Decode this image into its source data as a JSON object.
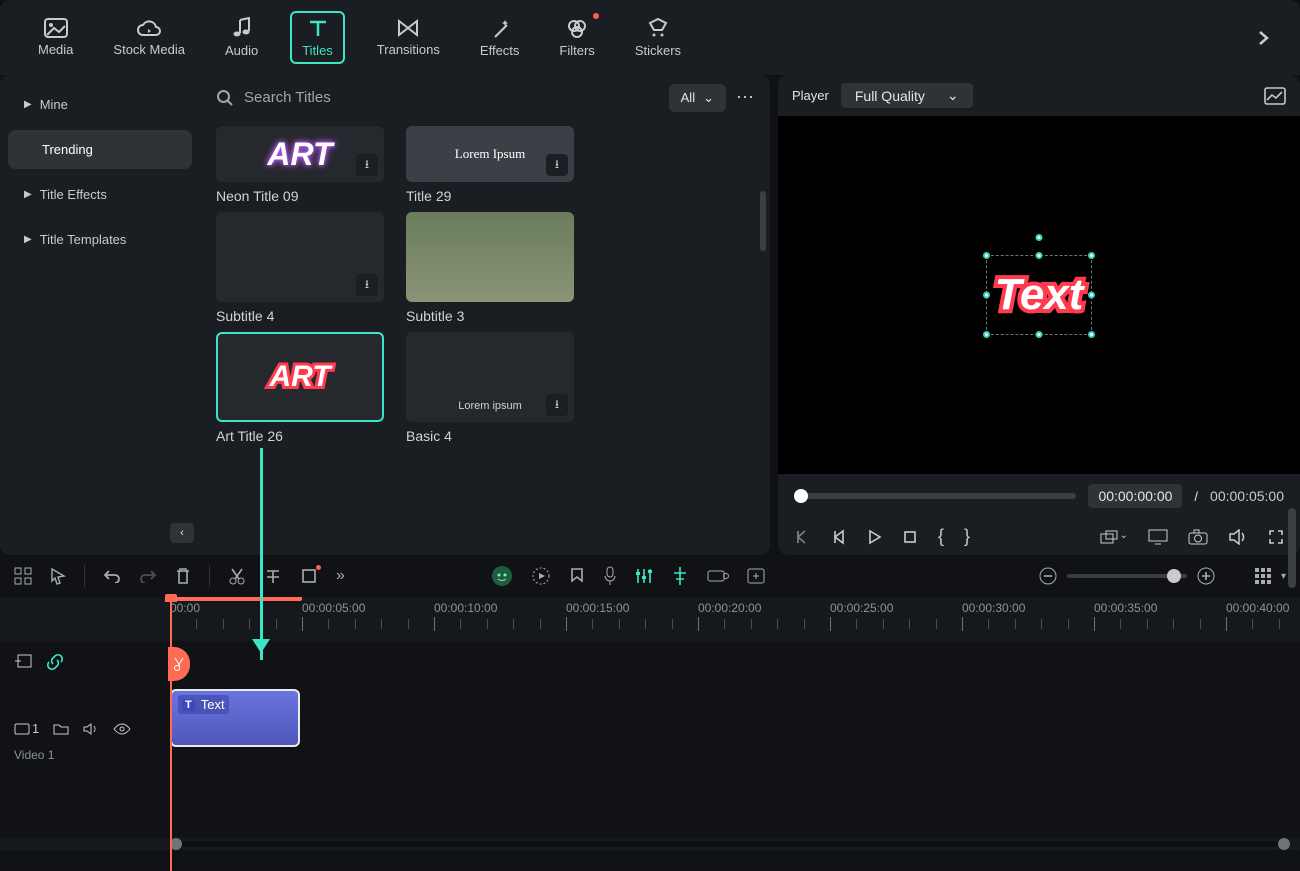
{
  "tabs": {
    "media": "Media",
    "stock": "Stock Media",
    "audio": "Audio",
    "titles": "Titles",
    "transitions": "Transitions",
    "effects": "Effects",
    "filters": "Filters",
    "stickers": "Stickers"
  },
  "sidebar": {
    "mine": "Mine",
    "trending": "Trending",
    "title_effects": "Title Effects",
    "title_templates": "Title Templates"
  },
  "search": {
    "placeholder": "Search Titles",
    "filter": "All"
  },
  "thumbs": {
    "neon09": {
      "label": "Neon Title 09",
      "graphic": "ART"
    },
    "title29": {
      "label": "Title 29",
      "graphic": "Lorem Ipsum"
    },
    "sub4": {
      "label": "Subtitle 4"
    },
    "sub3": {
      "label": "Subtitle 3"
    },
    "art26": {
      "label": "Art Title 26",
      "graphic": "ART"
    },
    "basic4": {
      "label": "Basic 4",
      "graphic": "Lorem ipsum"
    }
  },
  "player": {
    "label": "Player",
    "quality": "Full Quality",
    "preview_text": "Text",
    "current": "00:00:00:00",
    "sep": "/",
    "total": "00:00:05:00"
  },
  "timeline": {
    "marks": [
      "00:00",
      "00:00:05:00",
      "00:00:10:00",
      "00:00:15:00",
      "00:00:20:00",
      "00:00:25:00",
      "00:00:30:00",
      "00:00:35:00",
      "00:00:40:00"
    ],
    "clip_text": "Text",
    "track1": {
      "label": "Video 1",
      "badge": "1"
    }
  }
}
